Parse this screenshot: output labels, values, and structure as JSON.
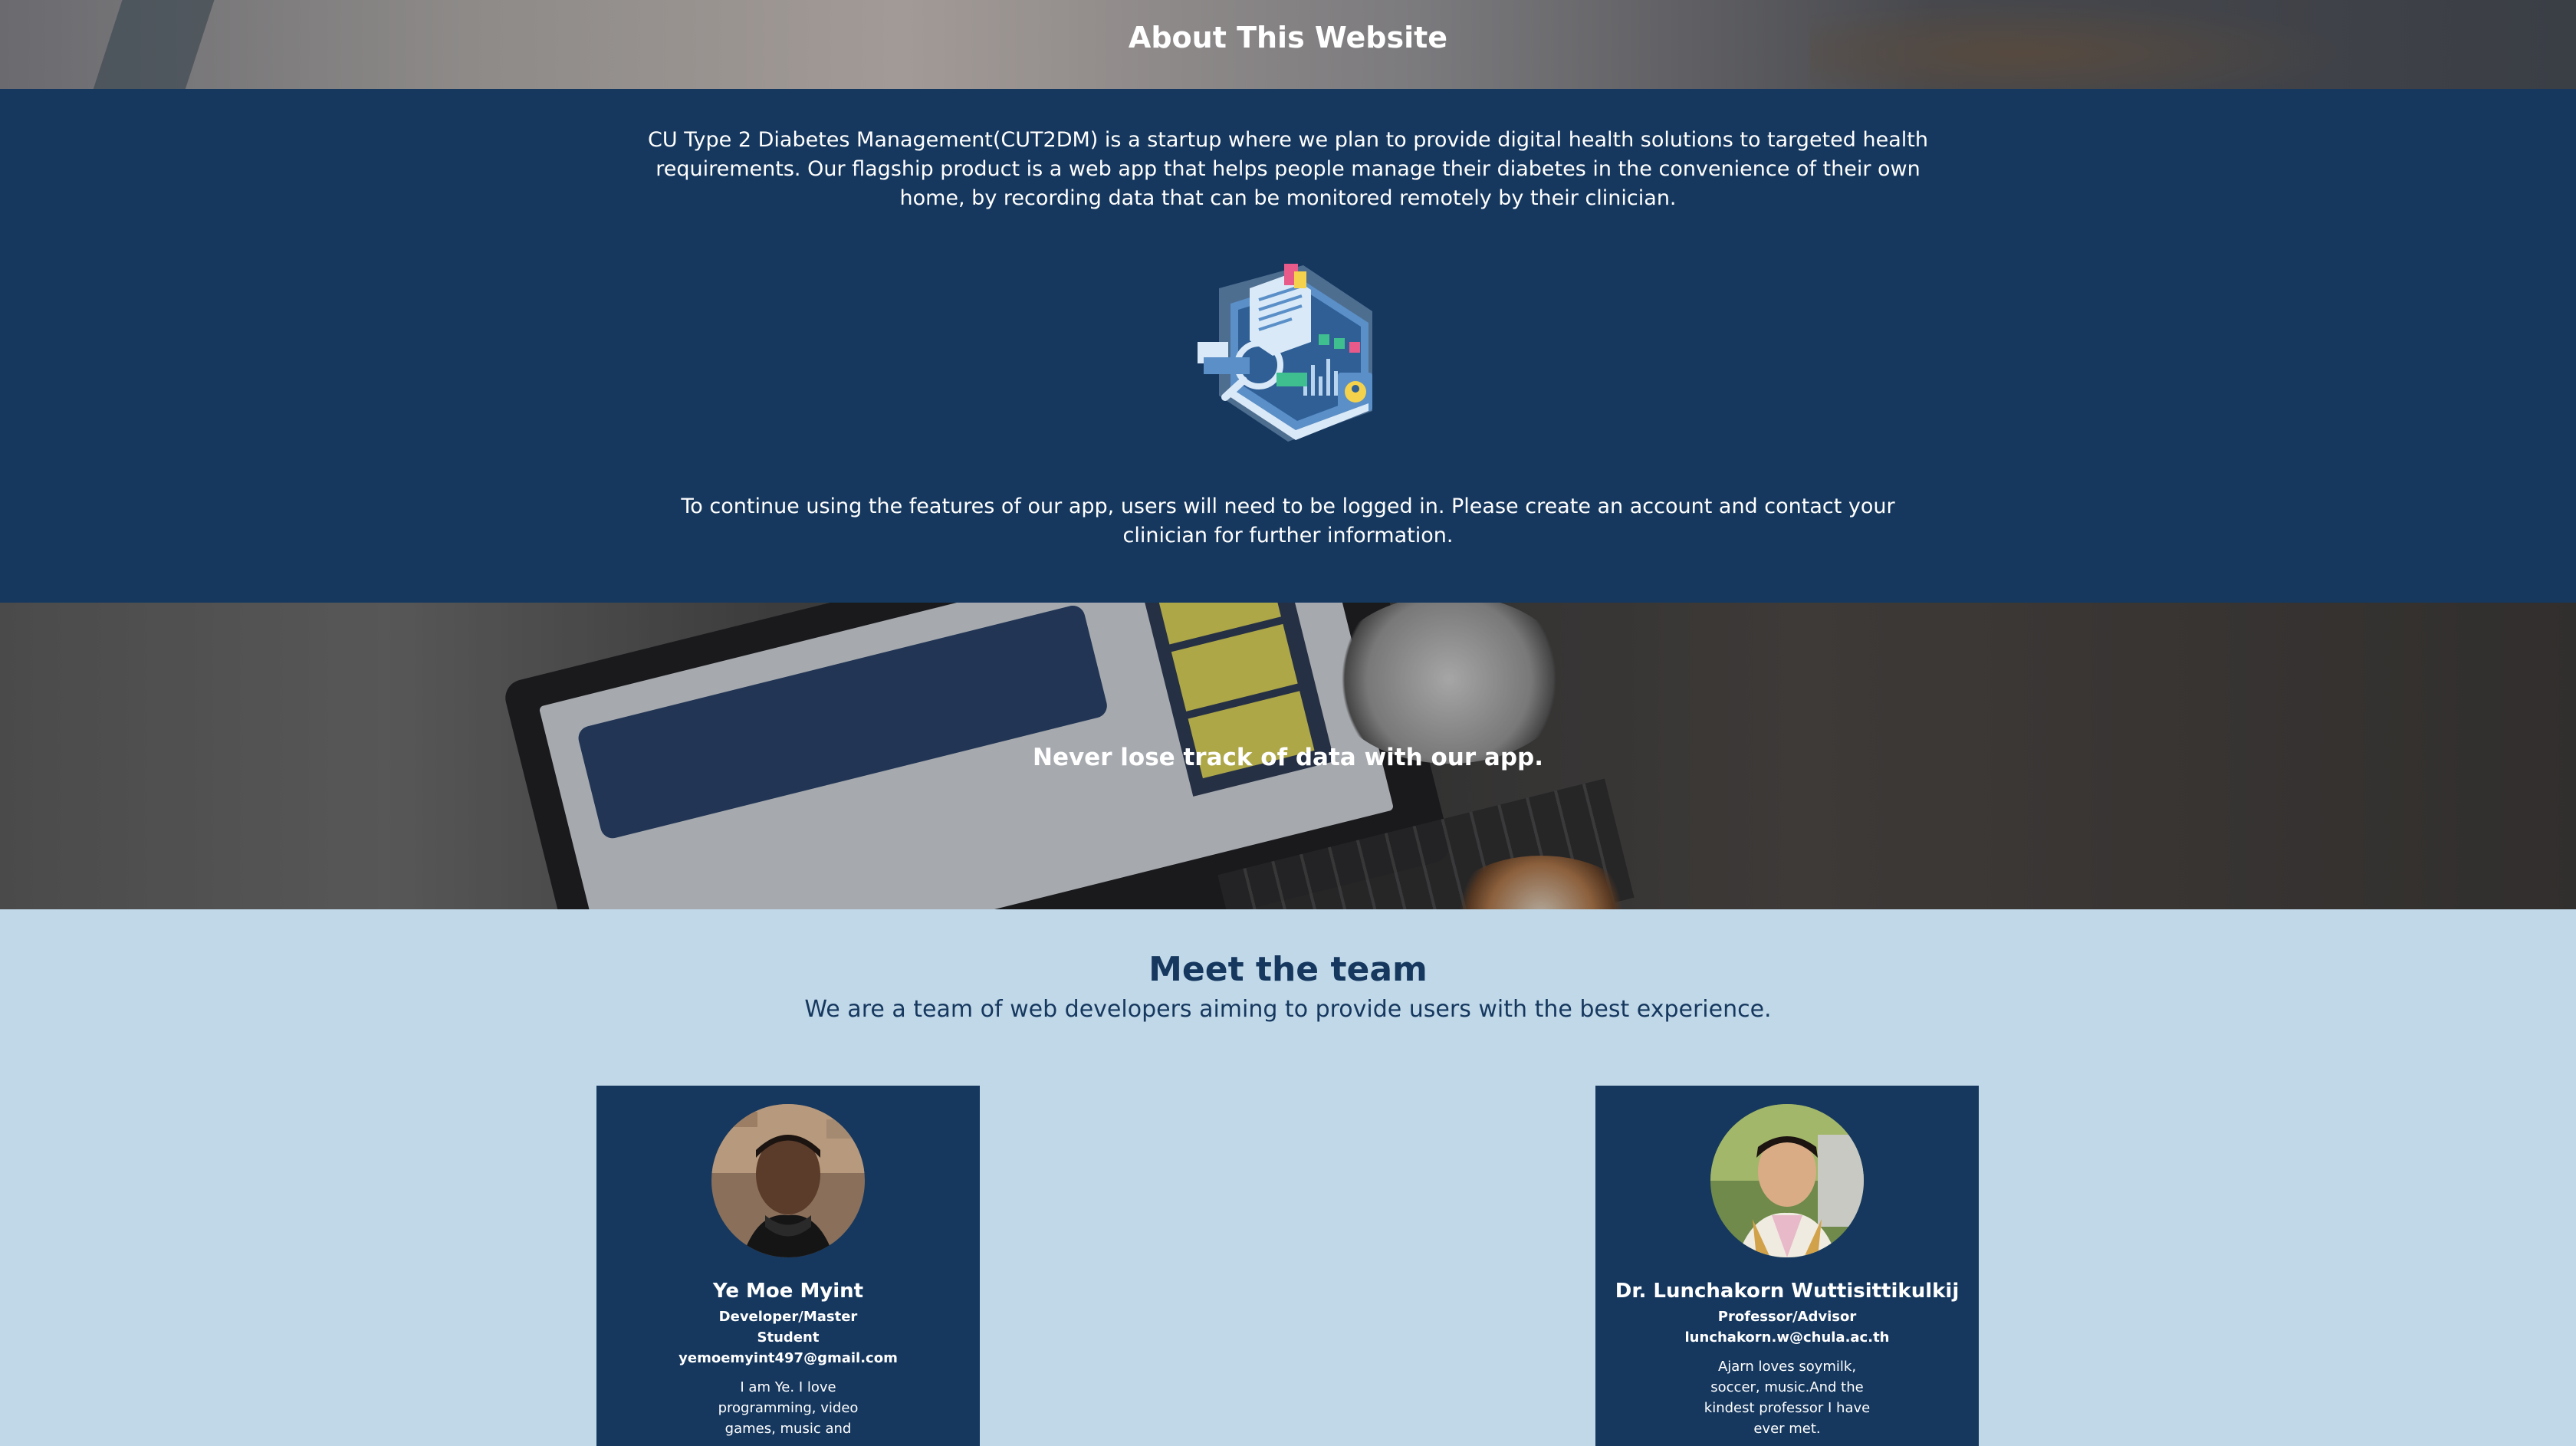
{
  "hero": {
    "title": "About This Website"
  },
  "about": {
    "description": "CU Type 2 Diabetes Management(CUT2DM) is a startup where we plan to provide digital health solutions to targeted health requirements. Our flagship product is a web app that helps people manage their diabetes in the convenience of their own home, by recording data that can be monitored remotely by their clinician.",
    "login_notice": "To continue using the features of our app, users will need to be logged in. Please create an account and contact your clinician for further information."
  },
  "banner": {
    "tagline": "Never lose track of data with our app."
  },
  "team": {
    "title": "Meet the team",
    "subtitle": "We are a team of web developers aiming to provide users with the best experience.",
    "members": [
      {
        "name": "Ye Moe Myint",
        "role": "Developer/Master Student",
        "email": "yemoemyint497@gmail.com",
        "bio": "I am Ye. I love programming, video games, music and"
      },
      {
        "name": "Dr. Lunchakorn Wuttisittikulkij",
        "role": "Professor/Advisor",
        "email": "lunchakorn.w@chula.ac.th",
        "bio": "Ajarn loves soymilk, soccer, music.And the kindest professor I have ever met."
      }
    ]
  },
  "colors": {
    "navy": "#16385f",
    "light_blue": "#c0d8e8",
    "white": "#ffffff"
  }
}
